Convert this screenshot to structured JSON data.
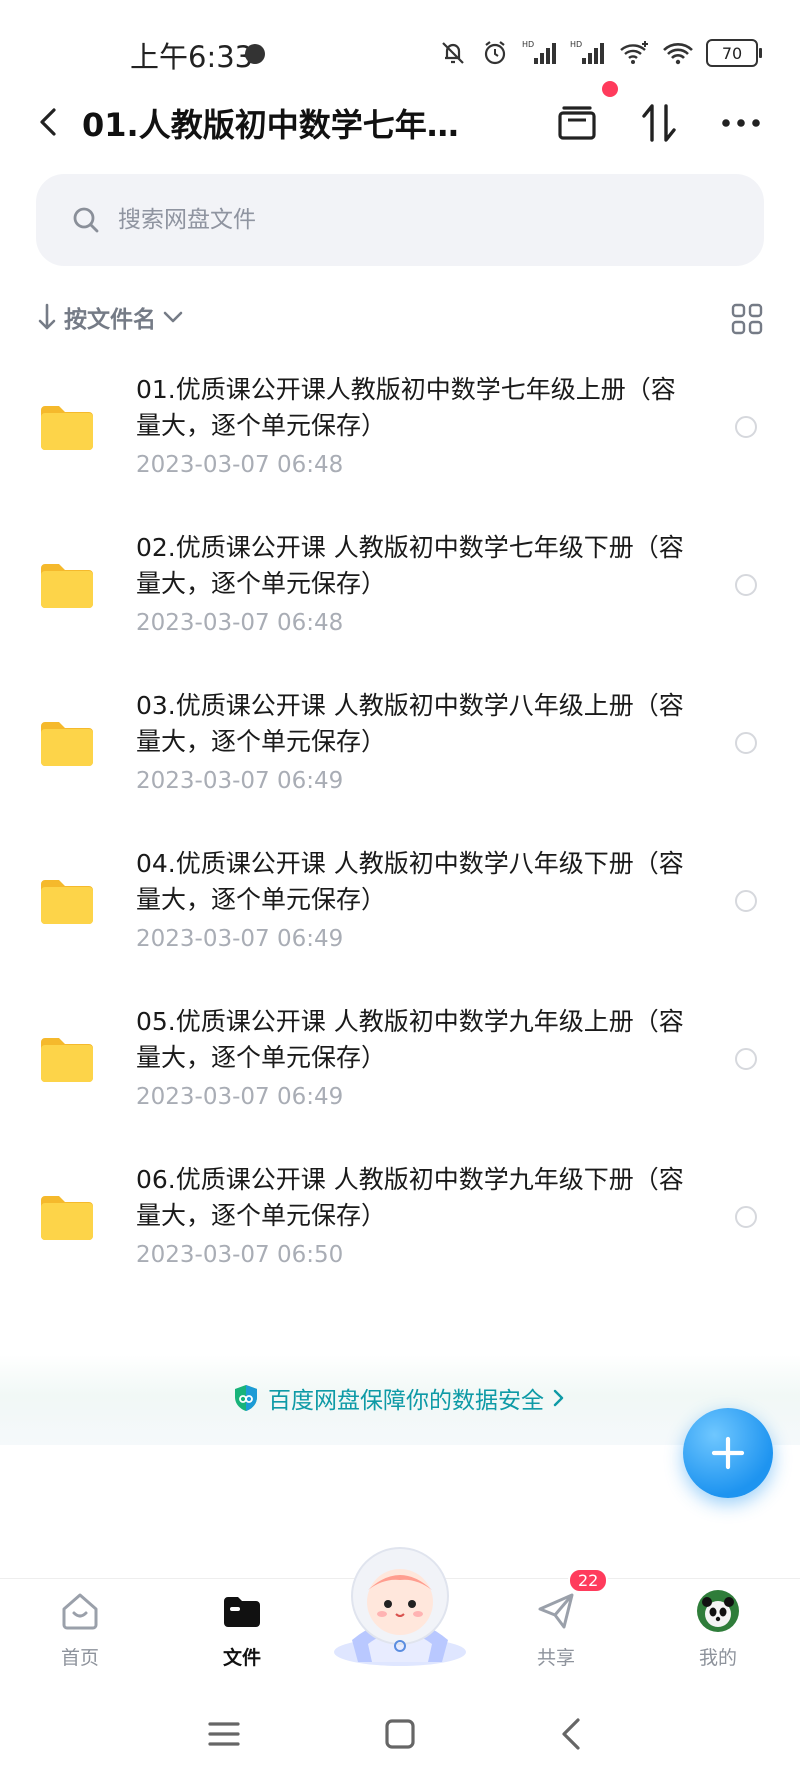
{
  "status_bar": {
    "time": "上午6:33",
    "battery": "70"
  },
  "header": {
    "title": "01.人教版初中数学七年级..."
  },
  "search": {
    "placeholder": "搜索网盘文件"
  },
  "sort": {
    "label": "按文件名"
  },
  "files": [
    {
      "name": "01.优质课公开课人教版初中数学七年级上册（容量大，逐个单元保存）",
      "date": "2023-03-07  06:48"
    },
    {
      "name": "02.优质课公开课 人教版初中数学七年级下册（容量大，逐个单元保存）",
      "date": "2023-03-07  06:48"
    },
    {
      "name": "03.优质课公开课  人教版初中数学八年级上册（容量大，逐个单元保存）",
      "date": "2023-03-07  06:49"
    },
    {
      "name": "04.优质课公开课  人教版初中数学八年级下册（容量大，逐个单元保存）",
      "date": "2023-03-07  06:49"
    },
    {
      "name": "05.优质课公开课  人教版初中数学九年级上册（容量大，逐个单元保存）",
      "date": "2023-03-07  06:49"
    },
    {
      "name": "06.优质课公开课  人教版初中数学九年级下册（容量大，逐个单元保存）",
      "date": "2023-03-07  06:50"
    }
  ],
  "security_banner": {
    "text": "百度网盘保障你的数据安全"
  },
  "bottom_nav": {
    "home": "首页",
    "files": "文件",
    "share": "共享",
    "share_badge": "22",
    "mine": "我的"
  },
  "colors": {
    "accent": "#1e94f0",
    "folder": "#fbcf3a",
    "badge": "#ff3b5c",
    "security": "#0e9aa6"
  }
}
